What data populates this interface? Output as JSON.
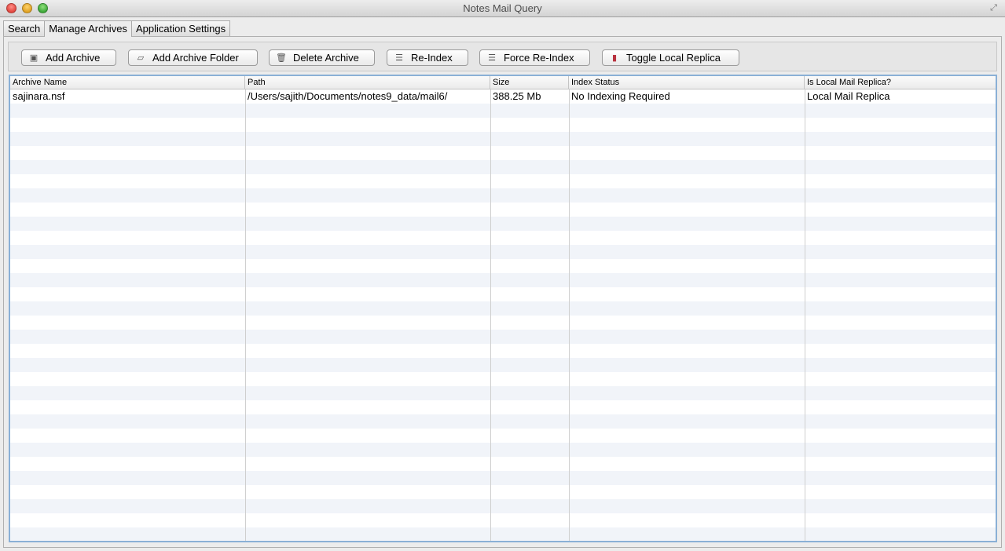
{
  "window": {
    "title": "Notes Mail Query"
  },
  "tabs": [
    {
      "label": "Search"
    },
    {
      "label": "Manage Archives"
    },
    {
      "label": "Application Settings"
    }
  ],
  "toolbar": {
    "add_archive": "Add Archive",
    "add_archive_folder": "Add Archive Folder",
    "delete_archive": "Delete Archive",
    "reindex": "Re-Index",
    "force_reindex": "Force Re-Index",
    "toggle_local_replica": "Toggle Local Replica"
  },
  "table": {
    "columns": [
      "Archive Name",
      "Path",
      "Size",
      "Index Status",
      "Is Local Mail Replica?"
    ],
    "rows": [
      {
        "archive_name": "sajinara.nsf",
        "path": "/Users/sajith/Documents/notes9_data/mail6/",
        "size": "388.25 Mb",
        "index_status": "No Indexing Required",
        "is_local_replica": "Local Mail Replica"
      }
    ]
  }
}
